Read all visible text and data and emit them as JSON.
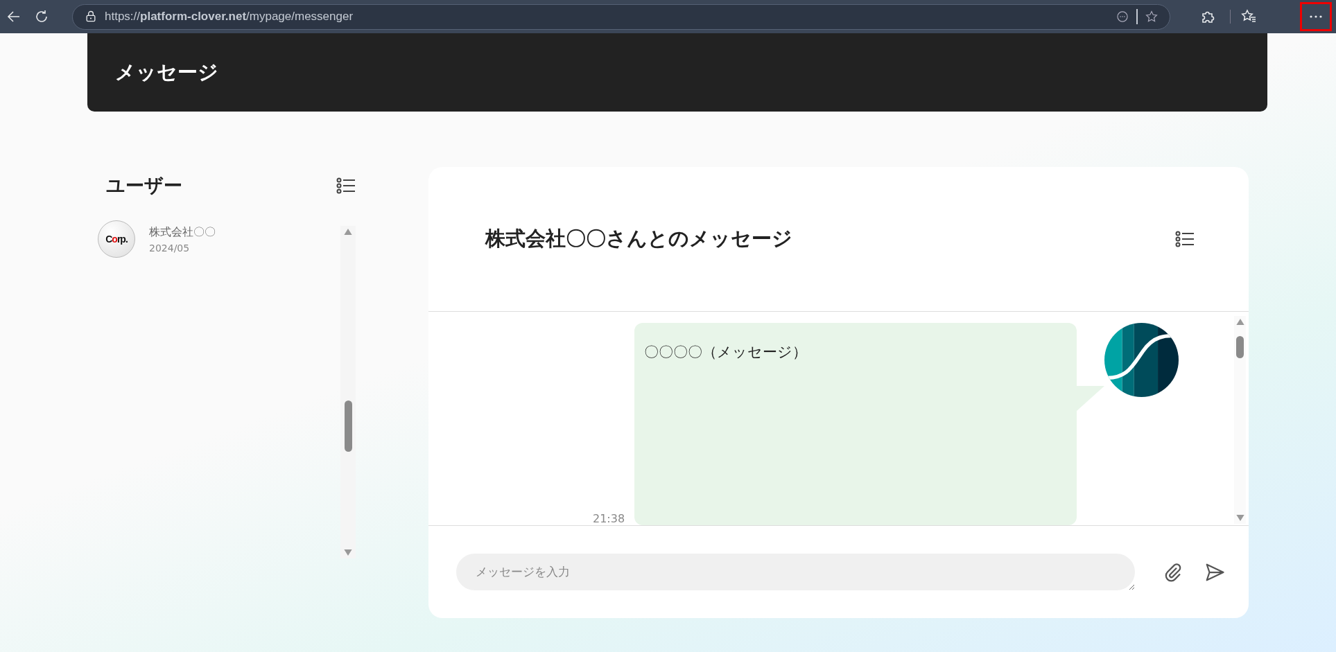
{
  "browser": {
    "url": "https://**platform-clover.net**/mypage/messenger",
    "more_button": {
      "highlighted": true
    }
  },
  "header": {
    "title": "メッセージ"
  },
  "users": {
    "title": "ユーザー",
    "items": [
      {
        "name": "株式会社〇〇",
        "date": "2024/05",
        "selected": false,
        "logo": [
          {
            "text": "C",
            "accent": false
          },
          {
            "text": "o",
            "accent": true
          },
          {
            "text": "rp.",
            "accent": false
          }
        ]
      }
    ]
  },
  "chat": {
    "title": "株式会社〇〇さんとのメッセージ",
    "messages": [
      {
        "text": "〇〇〇〇（メッセージ）",
        "time": "21:38"
      }
    ],
    "input": {
      "placeholder": "メッセージを入力"
    }
  }
}
